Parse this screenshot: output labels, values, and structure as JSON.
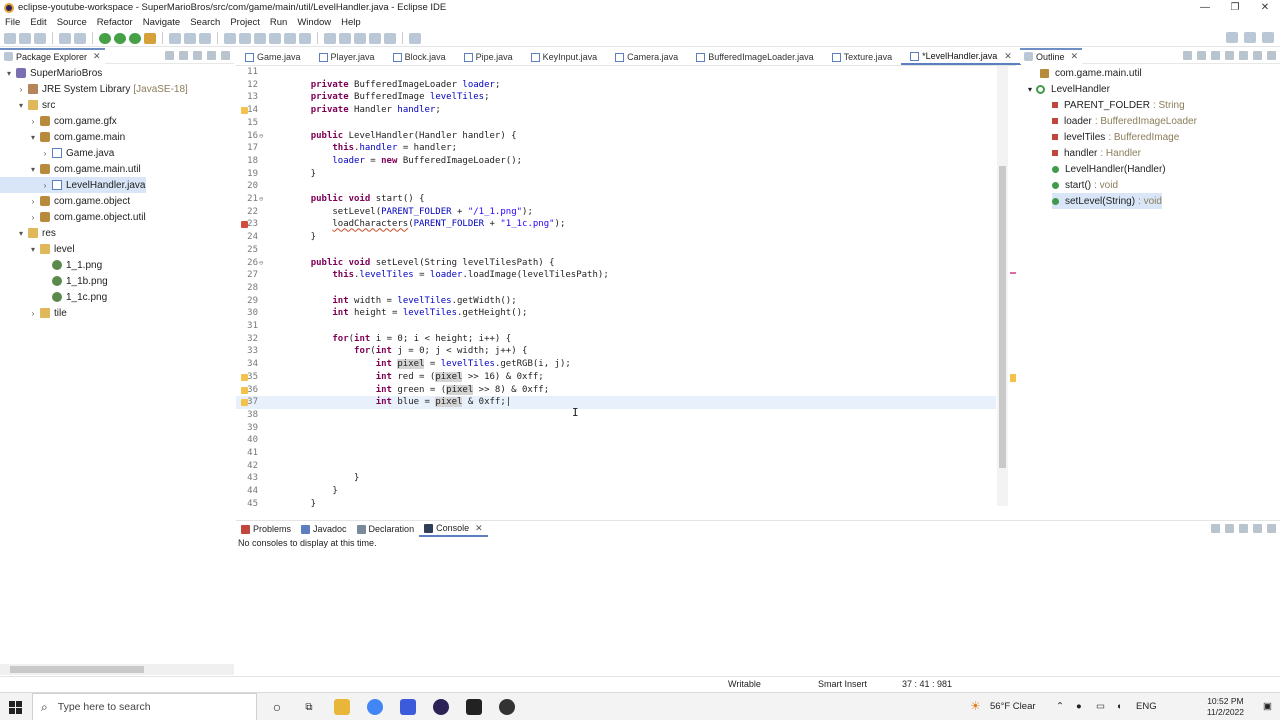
{
  "window": {
    "title": "eclipse-youtube-workspace - SuperMarioBros/src/com/game/main/util/LevelHandler.java - Eclipse IDE",
    "controls": [
      "—",
      "❐",
      "✕"
    ]
  },
  "menu": [
    "File",
    "Edit",
    "Source",
    "Refactor",
    "Navigate",
    "Search",
    "Project",
    "Run",
    "Window",
    "Help"
  ],
  "package_explorer": {
    "title": "Package Explorer",
    "tree": [
      {
        "label": "SuperMarioBros",
        "icon": "project-icon",
        "twisty": "▾",
        "depth": 0
      },
      {
        "label": "JRE System Library",
        "extra": "[JavaSE-18]",
        "icon": "library-icon",
        "twisty": "›",
        "depth": 1
      },
      {
        "label": "src",
        "icon": "folder-icon",
        "twisty": "▾",
        "depth": 1
      },
      {
        "label": "com.game.gfx",
        "icon": "package-icon",
        "twisty": "›",
        "depth": 2
      },
      {
        "label": "com.game.main",
        "icon": "package-icon",
        "twisty": "▾",
        "depth": 2
      },
      {
        "label": "Game.java",
        "icon": "java-file-icon",
        "twisty": "›",
        "depth": 3
      },
      {
        "label": "com.game.main.util",
        "icon": "package-icon",
        "twisty": "▾",
        "depth": 2
      },
      {
        "label": "LevelHandler.java",
        "icon": "java-file-icon",
        "twisty": "›",
        "depth": 3,
        "selected": true
      },
      {
        "label": "com.game.object",
        "icon": "package-icon",
        "twisty": "›",
        "depth": 2
      },
      {
        "label": "com.game.object.util",
        "icon": "package-icon",
        "twisty": "›",
        "depth": 2
      },
      {
        "label": "res",
        "icon": "folder-icon",
        "twisty": "▾",
        "depth": 1
      },
      {
        "label": "level",
        "icon": "folder-icon",
        "twisty": "▾",
        "depth": 2
      },
      {
        "label": "1_1.png",
        "icon": "image-file-icon",
        "twisty": "",
        "depth": 3
      },
      {
        "label": "1_1b.png",
        "icon": "image-file-icon",
        "twisty": "",
        "depth": 3
      },
      {
        "label": "1_1c.png",
        "icon": "image-file-icon",
        "twisty": "",
        "depth": 3
      },
      {
        "label": "tile",
        "icon": "folder-icon",
        "twisty": "›",
        "depth": 2
      }
    ]
  },
  "editor_tabs": [
    {
      "label": "Game.java",
      "active": false
    },
    {
      "label": "Player.java",
      "active": false
    },
    {
      "label": "Block.java",
      "active": false
    },
    {
      "label": "Pipe.java",
      "active": false
    },
    {
      "label": "KeyInput.java",
      "active": false
    },
    {
      "label": "Camera.java",
      "active": false
    },
    {
      "label": "BufferedImageLoader.java",
      "active": false
    },
    {
      "label": "Texture.java",
      "active": false
    },
    {
      "label": "*LevelHandler.java",
      "active": true
    }
  ],
  "code_lines": [
    {
      "n": "11",
      "html": ""
    },
    {
      "n": "12",
      "html": "    <span class='kw'>private</span> BufferedImageLoader <span class='fld'>loader</span>;"
    },
    {
      "n": "13",
      "html": "    <span class='kw'>private</span> BufferedImage <span class='fld'>levelTiles</span>;"
    },
    {
      "n": "14",
      "html": "    <span class='kw'>private</span> Handler <span class='fld'>handler</span>;",
      "marker": "w"
    },
    {
      "n": "15",
      "html": ""
    },
    {
      "n": "16",
      "html": "    <span class='kw'>public</span> LevelHandler(Handler handler) {",
      "fold": true
    },
    {
      "n": "17",
      "html": "        <span class='kw'>this</span>.<span class='fld'>handler</span> = handler;"
    },
    {
      "n": "18",
      "html": "        <span class='fld'>loader</span> = <span class='kw'>new</span> BufferedImageLoader();"
    },
    {
      "n": "19",
      "html": "    }"
    },
    {
      "n": "20",
      "html": ""
    },
    {
      "n": "21",
      "html": "    <span class='kw'>public</span> <span class='kw'>void</span> start() {",
      "fold": true
    },
    {
      "n": "22",
      "html": "        setLevel(<span class='fld'>PARENT_FOLDER</span> + <span class='str'>\"/1_1.png\"</span>);"
    },
    {
      "n": "23",
      "html": "        <span class='warn'>loadCharacters</span>(<span class='fld'>PARENT_FOLDER</span> + <span class='str'>\"1_1c.png\"</span>);",
      "marker": "e"
    },
    {
      "n": "24",
      "html": "    }"
    },
    {
      "n": "25",
      "html": ""
    },
    {
      "n": "26",
      "html": "    <span class='kw'>public</span> <span class='kw'>void</span> setLevel(String levelTilesPath) {",
      "fold": true
    },
    {
      "n": "27",
      "html": "        <span class='kw'>this</span>.<span class='fld'>levelTiles</span> = <span class='fld'>loader</span>.loadImage(levelTilesPath);"
    },
    {
      "n": "28",
      "html": ""
    },
    {
      "n": "29",
      "html": "        <span class='kw'>int</span> width = <span class='fld'>levelTiles</span>.getWidth();"
    },
    {
      "n": "30",
      "html": "        <span class='kw'>int</span> height = <span class='fld'>levelTiles</span>.getHeight();"
    },
    {
      "n": "31",
      "html": ""
    },
    {
      "n": "32",
      "html": "        <span class='kw'>for</span>(<span class='kw'>int</span> i = 0; i &lt; height; i++) {"
    },
    {
      "n": "33",
      "html": "            <span class='kw'>for</span>(<span class='kw'>int</span> j = 0; j &lt; width; j++) {"
    },
    {
      "n": "34",
      "html": "                <span class='kw'>int</span> <span class='hl'>pixel</span> = <span class='fld'>levelTiles</span>.getRGB(i, j);"
    },
    {
      "n": "35",
      "html": "                <span class='kw'>int</span> red = (<span class='hl'>pixel</span> &gt;&gt; 16) &amp; 0xff;",
      "marker": "w"
    },
    {
      "n": "36",
      "html": "                <span class='kw'>int</span> green = (<span class='hl'>pixel</span> &gt;&gt; 8) &amp; 0xff;",
      "marker": "w"
    },
    {
      "n": "37",
      "html": "                <span class='kw'>int</span> blue = <span class='hl'>pixel</span> &amp; 0xff;|",
      "marker": "w",
      "current": true
    },
    {
      "n": "38",
      "html": ""
    },
    {
      "n": "39",
      "html": ""
    },
    {
      "n": "40",
      "html": ""
    },
    {
      "n": "41",
      "html": ""
    },
    {
      "n": "42",
      "html": ""
    },
    {
      "n": "43",
      "html": "            }"
    },
    {
      "n": "44",
      "html": "        }"
    },
    {
      "n": "45",
      "html": "    }"
    }
  ],
  "outline": {
    "title": "Outline",
    "items": [
      {
        "label": "com.game.main.util",
        "type": "",
        "kind": "package",
        "depth": 0
      },
      {
        "label": "LevelHandler",
        "type": "",
        "kind": "class",
        "depth": 0,
        "twisty": "▾"
      },
      {
        "label": "PARENT_FOLDER",
        "type": ": String",
        "kind": "private",
        "depth": 1
      },
      {
        "label": "loader",
        "type": ": BufferedImageLoader",
        "kind": "private",
        "depth": 1
      },
      {
        "label": "levelTiles",
        "type": ": BufferedImage",
        "kind": "private",
        "depth": 1
      },
      {
        "label": "handler",
        "type": ": Handler",
        "kind": "private",
        "depth": 1
      },
      {
        "label": "LevelHandler(Handler)",
        "type": "",
        "kind": "public",
        "depth": 1
      },
      {
        "label": "start()",
        "type": ": void",
        "kind": "public",
        "depth": 1
      },
      {
        "label": "setLevel(String)",
        "type": ": void",
        "kind": "public",
        "depth": 1,
        "selected": true
      }
    ]
  },
  "bottom_panel": {
    "tabs": [
      {
        "label": "Problems",
        "active": false
      },
      {
        "label": "Javadoc",
        "active": false
      },
      {
        "label": "Declaration",
        "active": false
      },
      {
        "label": "Console",
        "active": true
      }
    ],
    "message": "No consoles to display at this time."
  },
  "status": {
    "writable": "Writable",
    "insert_mode": "Smart Insert",
    "position": "37 : 41 : 981"
  },
  "taskbar": {
    "search_placeholder": "Type here to search",
    "weather": "56°F  Clear",
    "lang": "ENG",
    "time": "10:52 PM",
    "date": "11/2/2022"
  }
}
